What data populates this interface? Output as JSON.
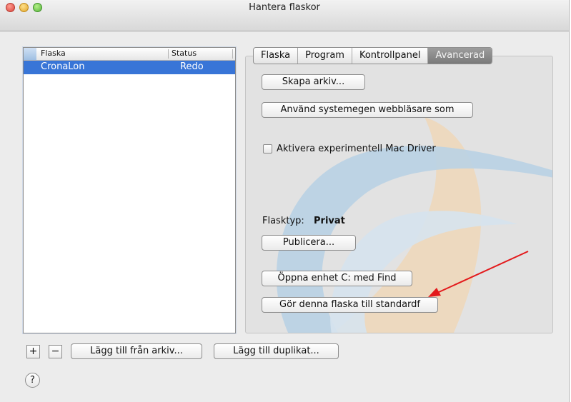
{
  "window": {
    "title": "Hantera flaskor"
  },
  "table": {
    "headers": {
      "name": "Flaska",
      "status": "Status"
    },
    "rows": [
      {
        "name": "CronaLon",
        "status": "Redo"
      }
    ]
  },
  "tabs": [
    {
      "label": "Flaska",
      "active": false
    },
    {
      "label": "Program",
      "active": false
    },
    {
      "label": "Kontrollpanel",
      "active": false
    },
    {
      "label": "Avancerad",
      "active": true
    }
  ],
  "advanced": {
    "create_archive": "Skapa arkiv...",
    "use_system_browser": "Använd systemegen webbläsare som",
    "experimental_checkbox": "Aktivera experimentell Mac Driver",
    "experimental_checked": false,
    "bottle_type_label": "Flasktyp:",
    "bottle_type_value": "Privat",
    "publish": "Publicera...",
    "open_drive": "Öppna enhet C: med Find",
    "make_default": "Gör denna flaska till standardf"
  },
  "bottom": {
    "add": "+",
    "remove": "−",
    "add_from_archive": "Lägg till från arkiv...",
    "add_duplicate": "Lägg till duplikat...",
    "help": "?"
  },
  "colors": {
    "selection": "#3875d7",
    "annotation_arrow": "#e3191b"
  }
}
